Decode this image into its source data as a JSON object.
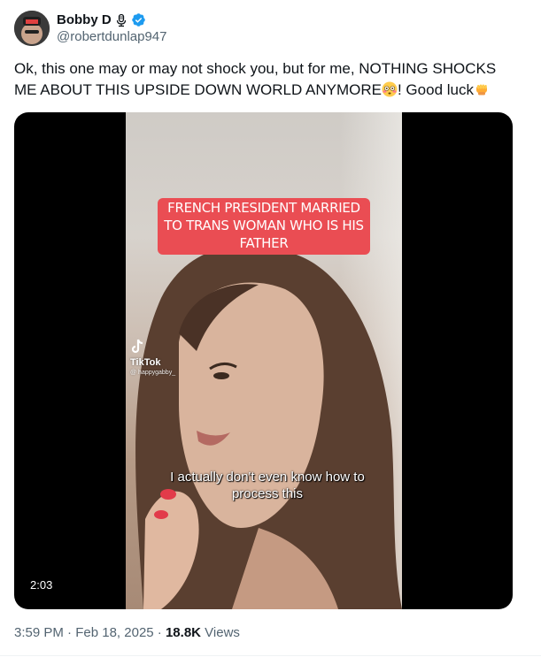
{
  "author": {
    "display_name": "Bobby D",
    "handle": "@robertdunlap947",
    "avatar_icon": "avatar-photo",
    "badges": [
      "microphone-icon",
      "verified-badge-icon"
    ],
    "verified_color": "#1d9bf0"
  },
  "tweet": {
    "text_part1": "Ok, this one may or may not shock you, but for me, NOTHING SHOCKS ME ABOUT THIS UPSIDE DOWN WORLD ANYMORE",
    "text_emoji1": "flushed-face-emoji",
    "text_part2": "! Good luck",
    "text_emoji2": "oncoming-fist-emoji"
  },
  "video": {
    "overlay_caption": "FRENCH PRESIDENT MARRIED TO TRANS WOMAN WHO IS HIS FATHER",
    "watermark_brand": "TikTok",
    "watermark_user": "@ happygabby_",
    "subtitle": "I actually don't even know how to process this",
    "duration": "2:03",
    "caption_color": "#ea4d53"
  },
  "meta": {
    "time": "3:59 PM",
    "sep1": " · ",
    "date": "Feb 18, 2025",
    "sep2": " · ",
    "views_count": "18.8K",
    "views_label": " Views"
  }
}
